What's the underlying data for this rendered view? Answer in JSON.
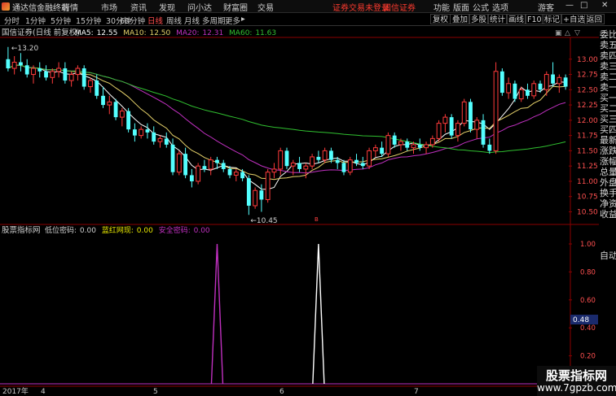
{
  "title_bar": {
    "app_title": "通达信金融终端",
    "menu": [
      "行情",
      "市场",
      "资讯",
      "发现",
      "问小达",
      "财富圈",
      "交易"
    ],
    "status_text": "证券交易未登录",
    "broker": "国信证券",
    "right_menu": [
      "功能",
      "版面",
      "公式",
      "选项"
    ],
    "guest": "游客",
    "win_min": "—",
    "win_max": "□",
    "win_close": "✕"
  },
  "toolbar": {
    "periods": [
      "分时",
      "1分钟",
      "5分钟",
      "15分钟",
      "30分钟",
      "60分钟",
      "日线",
      "周线",
      "月线",
      "多周期",
      "更多"
    ],
    "active_period": "日线",
    "more_arrow": "▸",
    "right_buttons": [
      "复权",
      "叠加",
      "多股",
      "统计",
      "画线",
      "F10",
      "标记",
      "+自选",
      "返回"
    ]
  },
  "main_chart": {
    "header": "国信证券(日线 前复权)",
    "ma_values": [
      {
        "label": "MA5:",
        "value": "12.55",
        "color": "#ffffff"
      },
      {
        "label": "MA10:",
        "value": "12.50",
        "color": "#e6d26a"
      },
      {
        "label": "MA20:",
        "value": "12.31",
        "color": "#c030c0"
      },
      {
        "label": "MA60:",
        "value": "11.63",
        "color": "#30c030"
      }
    ],
    "high_label": "13.20",
    "low_label": "10.45",
    "marker_text": "B",
    "price_ticks": [
      "13.00",
      "12.75",
      "12.50",
      "12.25",
      "12.00",
      "11.75",
      "11.50",
      "11.25",
      "11.00",
      "10.75",
      "10.50"
    ],
    "header_icons": [
      "▣",
      "△",
      "▽"
    ]
  },
  "indicator": {
    "title": "股票指标网",
    "values": [
      {
        "label": "低位密码:",
        "value": "0.00",
        "color": "#cfcfcf"
      },
      {
        "label": "蓝红网现:",
        "value": "0.00",
        "color": "#e8e800"
      },
      {
        "label": "安全密码:",
        "value": "0.00",
        "color": "#c030c0"
      }
    ],
    "ticks": [
      "1.00",
      "0.80",
      "0.60",
      "0.40",
      "0.20",
      "0.00"
    ],
    "cursor_value": "0.48"
  },
  "date_axis": {
    "labels": [
      "2017年",
      "4",
      "5",
      "6",
      "7"
    ]
  },
  "side_panel": {
    "items": [
      "委比",
      "卖五",
      "卖四",
      "卖三",
      "卖二",
      "卖一",
      "买一",
      "买二",
      "买三",
      "买四",
      "最新",
      "涨跌",
      "涨幅",
      "总量",
      "外盘",
      "换手",
      "净资",
      "收益"
    ],
    "bottom": "自动"
  },
  "watermark": {
    "line1": "股票指标网",
    "line2": "www.7gpzb.com"
  },
  "chart_data": {
    "type": "candlestick",
    "symbol": "国信证券",
    "period": "日线 前复权",
    "ylim": [
      10.45,
      13.2
    ],
    "candles": [
      {
        "o": 13.0,
        "h": 13.2,
        "l": 12.8,
        "c": 12.85
      },
      {
        "o": 12.85,
        "h": 13.05,
        "l": 12.75,
        "c": 12.95
      },
      {
        "o": 12.95,
        "h": 13.1,
        "l": 12.8,
        "c": 12.9
      },
      {
        "o": 12.9,
        "h": 13.0,
        "l": 12.7,
        "c": 12.75
      },
      {
        "o": 12.75,
        "h": 12.9,
        "l": 12.6,
        "c": 12.85
      },
      {
        "o": 12.85,
        "h": 12.95,
        "l": 12.7,
        "c": 12.8
      },
      {
        "o": 12.8,
        "h": 12.9,
        "l": 12.65,
        "c": 12.7
      },
      {
        "o": 12.7,
        "h": 12.85,
        "l": 12.6,
        "c": 12.8
      },
      {
        "o": 12.8,
        "h": 12.95,
        "l": 12.7,
        "c": 12.85
      },
      {
        "o": 12.85,
        "h": 12.95,
        "l": 12.6,
        "c": 12.65
      },
      {
        "o": 12.65,
        "h": 12.8,
        "l": 12.55,
        "c": 12.75
      },
      {
        "o": 12.75,
        "h": 12.9,
        "l": 12.65,
        "c": 12.85
      },
      {
        "o": 12.85,
        "h": 12.9,
        "l": 12.5,
        "c": 12.55
      },
      {
        "o": 12.55,
        "h": 12.7,
        "l": 12.45,
        "c": 12.65
      },
      {
        "o": 12.65,
        "h": 12.75,
        "l": 12.35,
        "c": 12.4
      },
      {
        "o": 12.4,
        "h": 12.55,
        "l": 12.2,
        "c": 12.25
      },
      {
        "o": 12.25,
        "h": 12.4,
        "l": 12.1,
        "c": 12.3
      },
      {
        "o": 12.3,
        "h": 12.35,
        "l": 12.0,
        "c": 12.05
      },
      {
        "o": 12.05,
        "h": 12.2,
        "l": 11.9,
        "c": 12.15
      },
      {
        "o": 12.15,
        "h": 12.2,
        "l": 11.8,
        "c": 11.85
      },
      {
        "o": 11.85,
        "h": 11.95,
        "l": 11.65,
        "c": 11.75
      },
      {
        "o": 11.75,
        "h": 11.9,
        "l": 11.7,
        "c": 11.85
      },
      {
        "o": 11.85,
        "h": 11.95,
        "l": 11.7,
        "c": 11.8
      },
      {
        "o": 11.8,
        "h": 11.9,
        "l": 11.6,
        "c": 11.65
      },
      {
        "o": 11.65,
        "h": 11.75,
        "l": 11.55,
        "c": 11.7
      },
      {
        "o": 11.7,
        "h": 11.8,
        "l": 11.55,
        "c": 11.6
      },
      {
        "o": 11.6,
        "h": 11.7,
        "l": 11.1,
        "c": 11.15
      },
      {
        "o": 11.15,
        "h": 11.5,
        "l": 11.1,
        "c": 11.45
      },
      {
        "o": 11.45,
        "h": 11.55,
        "l": 11.05,
        "c": 11.1
      },
      {
        "o": 11.1,
        "h": 11.2,
        "l": 10.9,
        "c": 11.0
      },
      {
        "o": 11.0,
        "h": 11.3,
        "l": 10.95,
        "c": 11.25
      },
      {
        "o": 11.25,
        "h": 11.35,
        "l": 11.15,
        "c": 11.2
      },
      {
        "o": 11.2,
        "h": 11.4,
        "l": 11.1,
        "c": 11.35
      },
      {
        "o": 11.35,
        "h": 11.4,
        "l": 11.2,
        "c": 11.3
      },
      {
        "o": 11.3,
        "h": 11.35,
        "l": 11.15,
        "c": 11.2
      },
      {
        "o": 11.2,
        "h": 11.25,
        "l": 11.05,
        "c": 11.1
      },
      {
        "o": 11.1,
        "h": 11.2,
        "l": 11.0,
        "c": 11.15
      },
      {
        "o": 11.15,
        "h": 11.2,
        "l": 11.0,
        "c": 11.05
      },
      {
        "o": 11.05,
        "h": 11.1,
        "l": 10.45,
        "c": 10.6
      },
      {
        "o": 10.6,
        "h": 10.9,
        "l": 10.55,
        "c": 10.85
      },
      {
        "o": 10.85,
        "h": 10.95,
        "l": 10.5,
        "c": 10.7
      },
      {
        "o": 10.7,
        "h": 11.2,
        "l": 10.65,
        "c": 11.15
      },
      {
        "o": 11.15,
        "h": 11.3,
        "l": 11.05,
        "c": 11.2
      },
      {
        "o": 11.2,
        "h": 11.55,
        "l": 11.1,
        "c": 11.5
      },
      {
        "o": 11.5,
        "h": 11.55,
        "l": 11.2,
        "c": 11.25
      },
      {
        "o": 11.25,
        "h": 11.35,
        "l": 11.1,
        "c": 11.3
      },
      {
        "o": 11.3,
        "h": 11.4,
        "l": 11.15,
        "c": 11.2
      },
      {
        "o": 11.2,
        "h": 11.3,
        "l": 11.05,
        "c": 11.25
      },
      {
        "o": 11.25,
        "h": 11.45,
        "l": 11.2,
        "c": 11.4
      },
      {
        "o": 11.4,
        "h": 11.5,
        "l": 11.3,
        "c": 11.35
      },
      {
        "o": 11.35,
        "h": 11.55,
        "l": 11.3,
        "c": 11.5
      },
      {
        "o": 11.5,
        "h": 11.55,
        "l": 11.3,
        "c": 11.35
      },
      {
        "o": 11.35,
        "h": 11.4,
        "l": 11.2,
        "c": 11.3
      },
      {
        "o": 11.3,
        "h": 11.35,
        "l": 11.1,
        "c": 11.15
      },
      {
        "o": 11.15,
        "h": 11.4,
        "l": 11.1,
        "c": 11.35
      },
      {
        "o": 11.35,
        "h": 11.45,
        "l": 11.25,
        "c": 11.3
      },
      {
        "o": 11.3,
        "h": 11.4,
        "l": 11.2,
        "c": 11.25
      },
      {
        "o": 11.25,
        "h": 11.55,
        "l": 11.2,
        "c": 11.5
      },
      {
        "o": 11.5,
        "h": 11.6,
        "l": 11.4,
        "c": 11.55
      },
      {
        "o": 11.55,
        "h": 11.65,
        "l": 11.4,
        "c": 11.45
      },
      {
        "o": 11.45,
        "h": 11.8,
        "l": 11.4,
        "c": 11.75
      },
      {
        "o": 11.75,
        "h": 11.8,
        "l": 11.55,
        "c": 11.6
      },
      {
        "o": 11.6,
        "h": 11.7,
        "l": 11.5,
        "c": 11.65
      },
      {
        "o": 11.65,
        "h": 11.7,
        "l": 11.5,
        "c": 11.55
      },
      {
        "o": 11.55,
        "h": 11.65,
        "l": 11.45,
        "c": 11.6
      },
      {
        "o": 11.6,
        "h": 11.7,
        "l": 11.5,
        "c": 11.55
      },
      {
        "o": 11.55,
        "h": 11.65,
        "l": 11.45,
        "c": 11.6
      },
      {
        "o": 11.6,
        "h": 11.75,
        "l": 11.55,
        "c": 11.7
      },
      {
        "o": 11.7,
        "h": 12.0,
        "l": 11.65,
        "c": 11.95
      },
      {
        "o": 11.95,
        "h": 12.1,
        "l": 11.8,
        "c": 12.05
      },
      {
        "o": 12.05,
        "h": 12.1,
        "l": 11.7,
        "c": 11.75
      },
      {
        "o": 11.75,
        "h": 12.0,
        "l": 11.65,
        "c": 11.95
      },
      {
        "o": 11.95,
        "h": 12.35,
        "l": 11.9,
        "c": 12.3
      },
      {
        "o": 12.3,
        "h": 12.35,
        "l": 11.8,
        "c": 11.85
      },
      {
        "o": 11.85,
        "h": 12.05,
        "l": 11.7,
        "c": 12.0
      },
      {
        "o": 12.0,
        "h": 12.1,
        "l": 11.55,
        "c": 11.6
      },
      {
        "o": 11.6,
        "h": 11.7,
        "l": 11.45,
        "c": 11.5
      },
      {
        "o": 11.5,
        "h": 12.95,
        "l": 11.45,
        "c": 12.8
      },
      {
        "o": 12.8,
        "h": 12.85,
        "l": 12.4,
        "c": 12.45
      },
      {
        "o": 12.45,
        "h": 12.7,
        "l": 12.35,
        "c": 12.6
      },
      {
        "o": 12.6,
        "h": 12.65,
        "l": 12.3,
        "c": 12.35
      },
      {
        "o": 12.35,
        "h": 12.55,
        "l": 12.3,
        "c": 12.5
      },
      {
        "o": 12.5,
        "h": 12.6,
        "l": 12.35,
        "c": 12.4
      },
      {
        "o": 12.4,
        "h": 12.65,
        "l": 12.35,
        "c": 12.6
      },
      {
        "o": 12.6,
        "h": 12.65,
        "l": 12.45,
        "c": 12.5
      },
      {
        "o": 12.5,
        "h": 12.8,
        "l": 12.4,
        "c": 12.75
      },
      {
        "o": 12.75,
        "h": 12.95,
        "l": 12.55,
        "c": 12.6
      },
      {
        "o": 12.6,
        "h": 12.75,
        "l": 12.45,
        "c": 12.7
      },
      {
        "o": 12.7,
        "h": 12.75,
        "l": 12.5,
        "c": 12.55
      }
    ],
    "indicator_spikes": [
      {
        "index": 33,
        "value": 1.0,
        "color": "#c030c0"
      },
      {
        "index": 49,
        "value": 1.0,
        "color": "#ffffff"
      }
    ],
    "indicator_ylim": [
      0,
      1
    ]
  }
}
